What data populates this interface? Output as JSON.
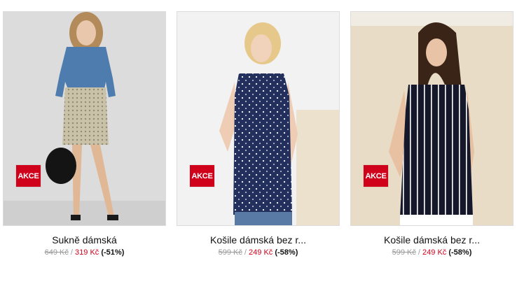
{
  "colors": {
    "accent": "#d0021b",
    "old_price": "#9a9a9a"
  },
  "products": [
    {
      "name": "Sukně dámská",
      "badge": "AKCE",
      "old_price": "649 Kč",
      "separator": "/",
      "new_price": "319 Kč",
      "discount": "(-51%)"
    },
    {
      "name": "Košile dámská bez r...",
      "badge": "AKCE",
      "old_price": "599 Kč",
      "separator": "/",
      "new_price": "249 Kč",
      "discount": "(-58%)"
    },
    {
      "name": "Košile dámská bez r...",
      "badge": "AKCE",
      "old_price": "599 Kč",
      "separator": "/",
      "new_price": "249 Kč",
      "discount": "(-58%)"
    }
  ]
}
